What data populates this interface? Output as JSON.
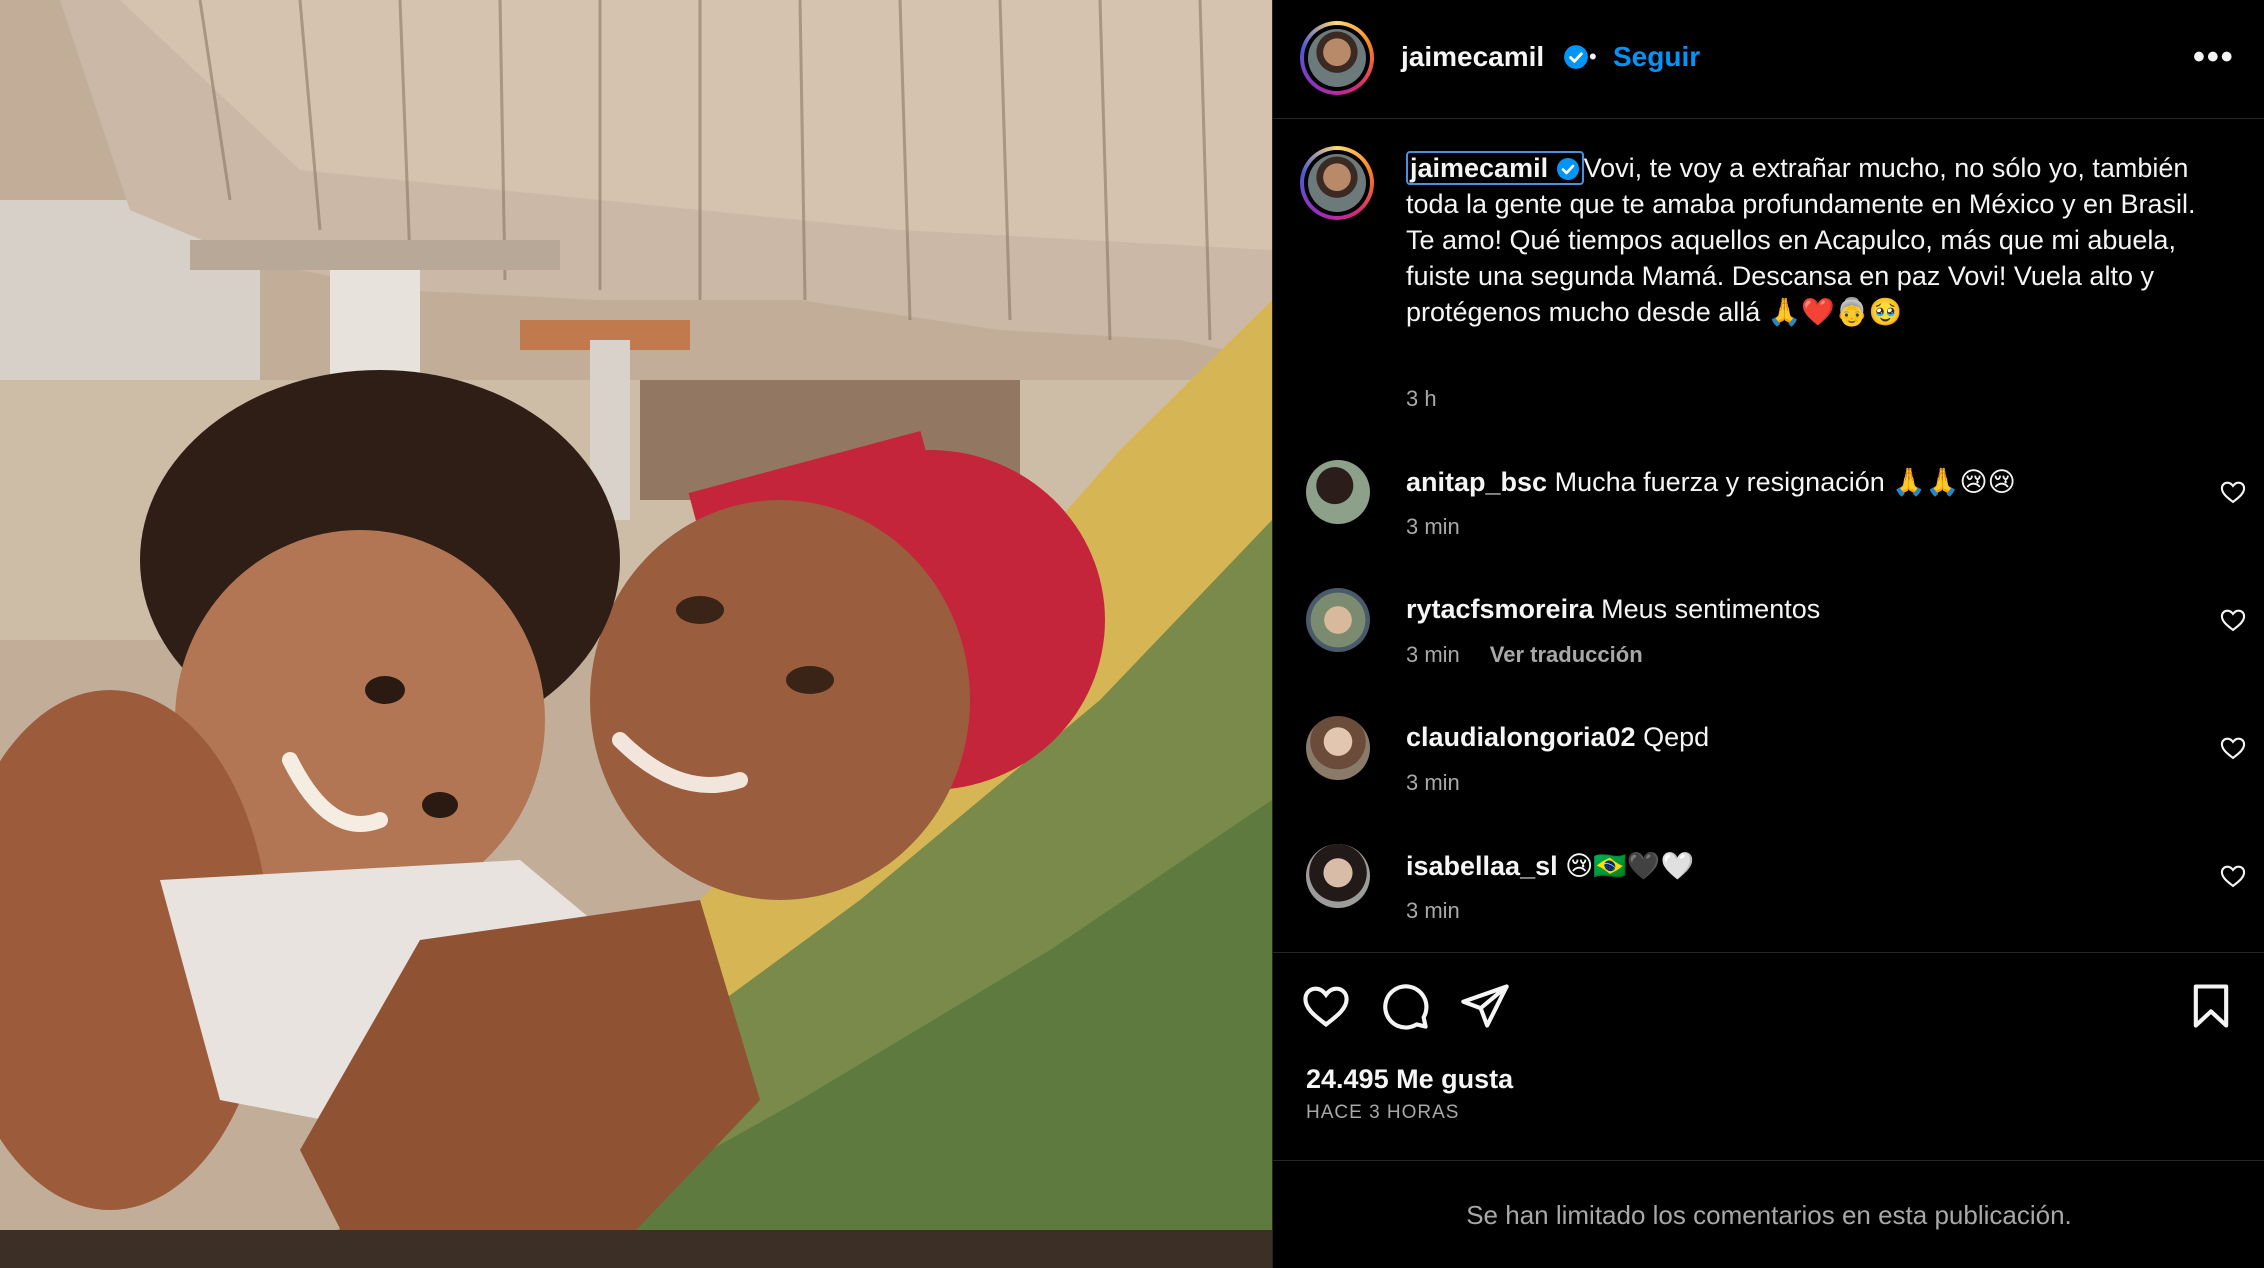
{
  "post": {
    "author": "jaimecamil",
    "follow_label": "Seguir",
    "more_label": "•••",
    "separator": "•",
    "caption_text": "Vovi, te voy a extrañar mucho, no sólo yo, también toda la gente que te amaba profundamente en México y en Brasil. Te amo! Qué tiempos aquellos en Acapulco, más que mi abuela, fuiste una segunda Mamá. Descansa en paz Vovi! Vuela alto y protégenos mucho desde allá 🙏❤️👵🥹",
    "caption_time": "3 h",
    "likes": "24.495 Me gusta",
    "posted_ago": "HACE 3 HORAS",
    "comments_limited": "Se han limitado los comentarios en esta publicación."
  },
  "comments": [
    {
      "user": "anitap_bsc",
      "text": "Mucha fuerza y resignación 🙏🙏😢😢",
      "time": "3 min",
      "translate": ""
    },
    {
      "user": "rytacfsmoreira",
      "text": "Meus sentimentos",
      "time": "3 min",
      "translate": "Ver traducción"
    },
    {
      "user": "claudialongoria02",
      "text": "Qepd",
      "time": "3 min",
      "translate": ""
    },
    {
      "user": "isabellaa_sl",
      "text": "😢🇧🇷🖤🤍",
      "time": "3 min",
      "translate": ""
    }
  ],
  "colors": {
    "accent": "#0095f6",
    "background": "#000000",
    "secondary_text": "#a8a8a8",
    "verified": "#0095f6"
  },
  "icons": [
    "verified-badge-icon",
    "more-options-icon",
    "heart-icon",
    "comment-icon",
    "share-icon",
    "bookmark-icon"
  ]
}
